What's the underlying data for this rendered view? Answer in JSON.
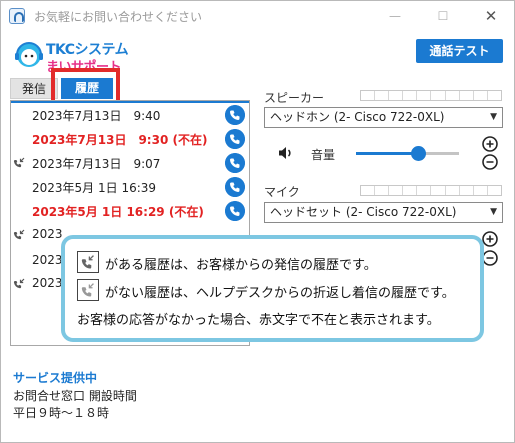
{
  "window": {
    "title": "お気軽にお問い合わせください",
    "controls": [
      "minimize-icon",
      "maximize-icon",
      "close-icon"
    ]
  },
  "logo": {
    "line1": "TKCシステム",
    "line2": "まいサポート"
  },
  "header": {
    "call_test_label": "通話テスト"
  },
  "tabs": [
    {
      "label": "発信",
      "active": false
    },
    {
      "label": "履歴",
      "active": true
    }
  ],
  "history": [
    {
      "datetime": "2023年7月13日　9:40",
      "absent": false,
      "incoming": false
    },
    {
      "datetime": "2023年7月13日　9:30 (不在)",
      "absent": true,
      "incoming": false
    },
    {
      "datetime": "2023年7月13日　9:07",
      "absent": false,
      "incoming": true
    },
    {
      "datetime": "2023年5月 1日 16:39",
      "absent": false,
      "incoming": false
    },
    {
      "datetime": "2023年5月 1日 16:29 (不在)",
      "absent": true,
      "incoming": false
    },
    {
      "datetime": "2023",
      "absent": false,
      "incoming": true
    },
    {
      "datetime": "2023",
      "absent": false,
      "incoming": false
    },
    {
      "datetime": "2023",
      "absent": false,
      "incoming": true
    }
  ],
  "audio": {
    "speaker_label": "スピーカー",
    "speaker_device": "ヘッドホン (2- Cisco 722-0XL)",
    "volume_label": "音量",
    "volume_level": 0.6,
    "mic_label": "マイク",
    "mic_device": "ヘッドセット (2- Cisco 722-0XL)"
  },
  "tooltip": {
    "line1": "がある履歴は、お客様からの発信の履歴です。",
    "line2": "がない履歴は、ヘルプデスクからの折返し着信の履歴です。",
    "line3": "お客様の応答がなかった場合、赤文字で不在と表示されます。"
  },
  "footer": {
    "status": "サービス提供中",
    "info_line1": "お問合せ窓口 開設時間",
    "info_line2": "平日９時～１８時"
  },
  "colors": {
    "accent": "#1b7ad1",
    "absent": "#e22222",
    "highlight": "#e22b2b",
    "tooltip_border": "#7dc7e2",
    "logo_pink": "#e6308a"
  }
}
